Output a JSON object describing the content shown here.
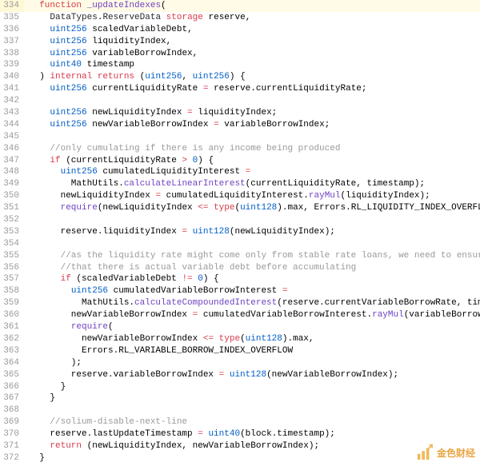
{
  "watermark_text": "金色财经",
  "lines": [
    {
      "n": 334,
      "hl": true,
      "tokens": [
        [
          "  ",
          ""
        ],
        [
          "function",
          "kw"
        ],
        [
          " ",
          ""
        ],
        [
          "_updateIndexes",
          "fn"
        ],
        [
          "(",
          ""
        ]
      ]
    },
    {
      "n": 335,
      "tokens": [
        [
          "    ",
          ""
        ],
        [
          "DataTypes",
          "ident"
        ],
        [
          ".",
          ""
        ],
        [
          "ReserveData",
          "ident"
        ],
        [
          " ",
          ""
        ],
        [
          "storage",
          "storage"
        ],
        [
          " ",
          ""
        ],
        [
          "reserve",
          ""
        ],
        [
          ",",
          ""
        ]
      ]
    },
    {
      "n": 336,
      "tokens": [
        [
          "    ",
          ""
        ],
        [
          "uint256",
          "type"
        ],
        [
          " ",
          ""
        ],
        [
          "scaledVariableDebt",
          ""
        ],
        [
          ",",
          ""
        ]
      ]
    },
    {
      "n": 337,
      "tokens": [
        [
          "    ",
          ""
        ],
        [
          "uint256",
          "type"
        ],
        [
          " ",
          ""
        ],
        [
          "liquidityIndex",
          ""
        ],
        [
          ",",
          ""
        ]
      ]
    },
    {
      "n": 338,
      "tokens": [
        [
          "    ",
          ""
        ],
        [
          "uint256",
          "type"
        ],
        [
          " ",
          ""
        ],
        [
          "variableBorrowIndex",
          ""
        ],
        [
          ",",
          ""
        ]
      ]
    },
    {
      "n": 339,
      "tokens": [
        [
          "    ",
          ""
        ],
        [
          "uint40",
          "type"
        ],
        [
          " ",
          ""
        ],
        [
          "timestamp",
          ""
        ]
      ]
    },
    {
      "n": 340,
      "tokens": [
        [
          "  ",
          ""
        ],
        [
          ") ",
          ""
        ],
        [
          "internal",
          "kw"
        ],
        [
          " ",
          ""
        ],
        [
          "returns",
          "kw"
        ],
        [
          " (",
          ""
        ],
        [
          "uint256",
          "type"
        ],
        [
          ", ",
          ""
        ],
        [
          "uint256",
          "type"
        ],
        [
          ") {",
          ""
        ]
      ]
    },
    {
      "n": 341,
      "tokens": [
        [
          "    ",
          ""
        ],
        [
          "uint256",
          "type"
        ],
        [
          " currentLiquidityRate ",
          ""
        ],
        [
          "=",
          "kw"
        ],
        [
          " reserve.currentLiquidityRate;",
          ""
        ]
      ]
    },
    {
      "n": 342,
      "tokens": [
        [
          "",
          ""
        ]
      ]
    },
    {
      "n": 343,
      "tokens": [
        [
          "    ",
          ""
        ],
        [
          "uint256",
          "type"
        ],
        [
          " newLiquidityIndex ",
          ""
        ],
        [
          "=",
          "kw"
        ],
        [
          " liquidityIndex;",
          ""
        ]
      ]
    },
    {
      "n": 344,
      "tokens": [
        [
          "    ",
          ""
        ],
        [
          "uint256",
          "type"
        ],
        [
          " newVariableBorrowIndex ",
          ""
        ],
        [
          "=",
          "kw"
        ],
        [
          " variableBorrowIndex;",
          ""
        ]
      ]
    },
    {
      "n": 345,
      "tokens": [
        [
          "",
          ""
        ]
      ]
    },
    {
      "n": 346,
      "tokens": [
        [
          "    ",
          ""
        ],
        [
          "//only cumulating if there is any income being produced",
          "comment"
        ]
      ]
    },
    {
      "n": 347,
      "tokens": [
        [
          "    ",
          ""
        ],
        [
          "if",
          "kw"
        ],
        [
          " (currentLiquidityRate ",
          ""
        ],
        [
          ">",
          "kw"
        ],
        [
          " ",
          ""
        ],
        [
          "0",
          "num"
        ],
        [
          ") {",
          ""
        ]
      ]
    },
    {
      "n": 348,
      "tokens": [
        [
          "      ",
          ""
        ],
        [
          "uint256",
          "type"
        ],
        [
          " cumulatedLiquidityInterest ",
          ""
        ],
        [
          "=",
          "kw"
        ]
      ]
    },
    {
      "n": 349,
      "tokens": [
        [
          "        MathUtils.",
          ""
        ],
        [
          "calculateLinearInterest",
          "fn"
        ],
        [
          "(currentLiquidityRate, timestamp);",
          ""
        ]
      ]
    },
    {
      "n": 350,
      "tokens": [
        [
          "      newLiquidityIndex ",
          ""
        ],
        [
          "=",
          "kw"
        ],
        [
          " cumulatedLiquidityInterest.",
          ""
        ],
        [
          "rayMul",
          "fn"
        ],
        [
          "(liquidityIndex);",
          ""
        ]
      ]
    },
    {
      "n": 351,
      "tokens": [
        [
          "      ",
          ""
        ],
        [
          "require",
          "fn"
        ],
        [
          "(newLiquidityIndex ",
          ""
        ],
        [
          "<=",
          "kw"
        ],
        [
          " ",
          ""
        ],
        [
          "type",
          "kw"
        ],
        [
          "(",
          ""
        ],
        [
          "uint128",
          "type"
        ],
        [
          ").max, Errors.RL_LIQUIDITY_INDEX_OVERFLOW);",
          ""
        ]
      ]
    },
    {
      "n": 352,
      "tokens": [
        [
          "",
          ""
        ]
      ]
    },
    {
      "n": 353,
      "tokens": [
        [
          "      reserve.liquidityIndex ",
          ""
        ],
        [
          "=",
          "kw"
        ],
        [
          " ",
          ""
        ],
        [
          "uint128",
          "type"
        ],
        [
          "(newLiquidityIndex);",
          ""
        ]
      ]
    },
    {
      "n": 354,
      "tokens": [
        [
          "",
          ""
        ]
      ]
    },
    {
      "n": 355,
      "tokens": [
        [
          "      ",
          ""
        ],
        [
          "//as the liquidity rate might come only from stable rate loans, we need to ensure",
          "comment"
        ]
      ]
    },
    {
      "n": 356,
      "tokens": [
        [
          "      ",
          ""
        ],
        [
          "//that there is actual variable debt before accumulating",
          "comment"
        ]
      ]
    },
    {
      "n": 357,
      "tokens": [
        [
          "      ",
          ""
        ],
        [
          "if",
          "kw"
        ],
        [
          " (scaledVariableDebt ",
          ""
        ],
        [
          "!=",
          "kw"
        ],
        [
          " ",
          ""
        ],
        [
          "0",
          "num"
        ],
        [
          ") {",
          ""
        ]
      ]
    },
    {
      "n": 358,
      "tokens": [
        [
          "        ",
          ""
        ],
        [
          "uint256",
          "type"
        ],
        [
          " cumulatedVariableBorrowInterest ",
          ""
        ],
        [
          "=",
          "kw"
        ]
      ]
    },
    {
      "n": 359,
      "tokens": [
        [
          "          MathUtils.",
          ""
        ],
        [
          "calculateCompoundedInterest",
          "fn"
        ],
        [
          "(reserve.currentVariableBorrowRate, timestamp);",
          ""
        ]
      ]
    },
    {
      "n": 360,
      "tokens": [
        [
          "        newVariableBorrowIndex ",
          ""
        ],
        [
          "=",
          "kw"
        ],
        [
          " cumulatedVariableBorrowInterest.",
          ""
        ],
        [
          "rayMul",
          "fn"
        ],
        [
          "(variableBorrowIndex);",
          ""
        ]
      ]
    },
    {
      "n": 361,
      "tokens": [
        [
          "        ",
          ""
        ],
        [
          "require",
          "fn"
        ],
        [
          "(",
          ""
        ]
      ]
    },
    {
      "n": 362,
      "tokens": [
        [
          "          newVariableBorrowIndex ",
          ""
        ],
        [
          "<=",
          "kw"
        ],
        [
          " ",
          ""
        ],
        [
          "type",
          "kw"
        ],
        [
          "(",
          ""
        ],
        [
          "uint128",
          "type"
        ],
        [
          ").max,",
          ""
        ]
      ]
    },
    {
      "n": 363,
      "tokens": [
        [
          "          Errors.RL_VARIABLE_BORROW_INDEX_OVERFLOW",
          ""
        ]
      ]
    },
    {
      "n": 364,
      "tokens": [
        [
          "        );",
          ""
        ]
      ]
    },
    {
      "n": 365,
      "tokens": [
        [
          "        reserve.variableBorrowIndex ",
          ""
        ],
        [
          "=",
          "kw"
        ],
        [
          " ",
          ""
        ],
        [
          "uint128",
          "type"
        ],
        [
          "(newVariableBorrowIndex);",
          ""
        ]
      ]
    },
    {
      "n": 366,
      "tokens": [
        [
          "      }",
          ""
        ]
      ]
    },
    {
      "n": 367,
      "tokens": [
        [
          "    }",
          ""
        ]
      ]
    },
    {
      "n": 368,
      "tokens": [
        [
          "",
          ""
        ]
      ]
    },
    {
      "n": 369,
      "tokens": [
        [
          "    ",
          ""
        ],
        [
          "//solium-disable-next-line",
          "comment"
        ]
      ]
    },
    {
      "n": 370,
      "tokens": [
        [
          "    reserve.lastUpdateTimestamp ",
          ""
        ],
        [
          "=",
          "kw"
        ],
        [
          " ",
          ""
        ],
        [
          "uint40",
          "type"
        ],
        [
          "(block.timestamp);",
          ""
        ]
      ]
    },
    {
      "n": 371,
      "tokens": [
        [
          "    ",
          ""
        ],
        [
          "return",
          "kw"
        ],
        [
          " (newLiquidityIndex, newVariableBorrowIndex);",
          ""
        ]
      ]
    },
    {
      "n": 372,
      "tokens": [
        [
          "  }",
          ""
        ]
      ]
    }
  ]
}
